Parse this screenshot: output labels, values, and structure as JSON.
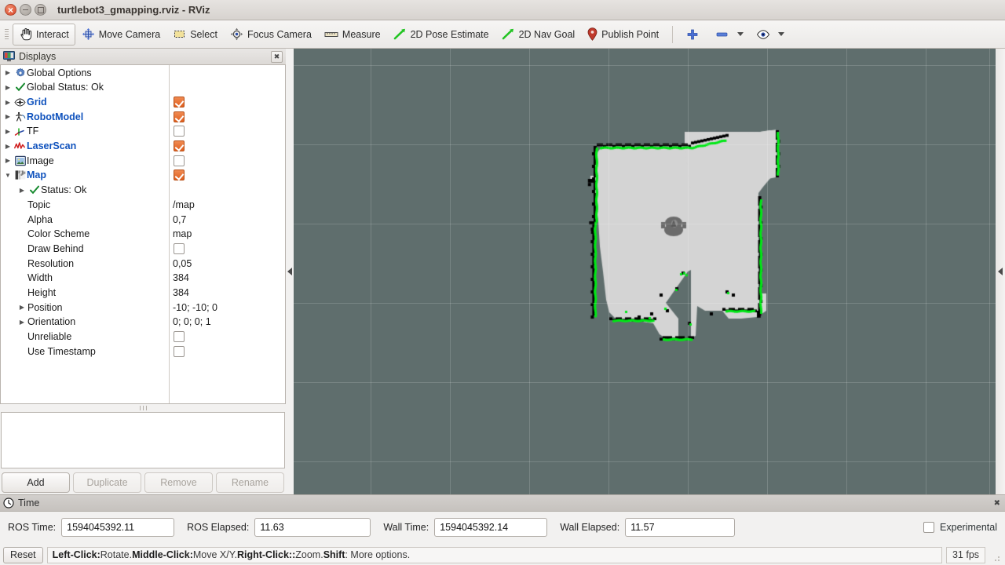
{
  "window": {
    "title": "turtlebot3_gmapping.rviz - RViz",
    "controls": [
      "close-button",
      "minimize-button",
      "maximize-button"
    ]
  },
  "toolbar": {
    "items": [
      {
        "label": "Interact",
        "icon": "hand-cursor-icon",
        "active": true
      },
      {
        "label": "Move Camera",
        "icon": "move-camera-icon",
        "active": false
      },
      {
        "label": "Select",
        "icon": "select-rect-icon",
        "active": false
      },
      {
        "label": "Focus Camera",
        "icon": "focus-camera-icon",
        "active": false
      },
      {
        "label": "Measure",
        "icon": "ruler-icon",
        "active": false
      },
      {
        "label": "2D Pose Estimate",
        "icon": "green-arrow-icon",
        "active": false
      },
      {
        "label": "2D Nav Goal",
        "icon": "green-arrow-icon",
        "active": false
      },
      {
        "label": "Publish Point",
        "icon": "map-pin-icon",
        "active": false
      }
    ],
    "right_icons": [
      "plus-icon",
      "minus-bar-icon",
      "eye-icon"
    ]
  },
  "displays_panel": {
    "title": "Displays",
    "icon": "displays-monitor-icon",
    "close_label": "✖",
    "tree": [
      {
        "label": "Global Options",
        "icon": "gear-icon",
        "indent": 0,
        "expander": "collapsed",
        "enabled_style": "plain",
        "checkbox": null
      },
      {
        "label": "Global Status: Ok",
        "icon": "check-icon",
        "indent": 0,
        "expander": "collapsed",
        "enabled_style": "plain",
        "checkbox": null
      },
      {
        "label": "Grid",
        "icon": "grid-icon",
        "indent": 0,
        "expander": "collapsed",
        "enabled_style": "enabled",
        "checkbox": "checked"
      },
      {
        "label": "RobotModel",
        "icon": "robot-icon",
        "indent": 0,
        "expander": "collapsed",
        "enabled_style": "enabled",
        "checkbox": "checked"
      },
      {
        "label": "TF",
        "icon": "tf-axes-icon",
        "indent": 0,
        "expander": "collapsed",
        "enabled_style": "plain",
        "checkbox": "unchecked"
      },
      {
        "label": "LaserScan",
        "icon": "laserscan-icon",
        "indent": 0,
        "expander": "collapsed",
        "enabled_style": "enabled",
        "checkbox": "checked"
      },
      {
        "label": "Image",
        "icon": "image-icon",
        "indent": 0,
        "expander": "collapsed",
        "enabled_style": "plain",
        "checkbox": "unchecked"
      },
      {
        "label": "Map",
        "icon": "map-icon",
        "indent": 0,
        "expander": "expanded",
        "enabled_style": "enabled",
        "checkbox": "checked"
      },
      {
        "label": "Status: Ok",
        "icon": "check-icon",
        "indent": 1,
        "expander": "collapsed",
        "enabled_style": "plain",
        "checkbox": null
      },
      {
        "label": "Topic",
        "icon": null,
        "indent": 1,
        "expander": "none",
        "enabled_style": "property",
        "value": "/map"
      },
      {
        "label": "Alpha",
        "icon": null,
        "indent": 1,
        "expander": "none",
        "enabled_style": "property",
        "value": "0,7"
      },
      {
        "label": "Color Scheme",
        "icon": null,
        "indent": 1,
        "expander": "none",
        "enabled_style": "property",
        "value": "map"
      },
      {
        "label": "Draw Behind",
        "icon": null,
        "indent": 1,
        "expander": "none",
        "enabled_style": "property",
        "checkbox": "unchecked"
      },
      {
        "label": "Resolution",
        "icon": null,
        "indent": 1,
        "expander": "none",
        "enabled_style": "property",
        "value": "0,05"
      },
      {
        "label": "Width",
        "icon": null,
        "indent": 1,
        "expander": "none",
        "enabled_style": "property",
        "value": "384"
      },
      {
        "label": "Height",
        "icon": null,
        "indent": 1,
        "expander": "none",
        "enabled_style": "property",
        "value": "384"
      },
      {
        "label": "Position",
        "icon": null,
        "indent": 1,
        "expander": "collapsed",
        "enabled_style": "property",
        "value": "-10; -10; 0"
      },
      {
        "label": "Orientation",
        "icon": null,
        "indent": 1,
        "expander": "collapsed",
        "enabled_style": "property",
        "value": "0; 0; 0; 1"
      },
      {
        "label": "Unreliable",
        "icon": null,
        "indent": 1,
        "expander": "none",
        "enabled_style": "property",
        "checkbox": "unchecked"
      },
      {
        "label": "Use Timestamp",
        "icon": null,
        "indent": 1,
        "expander": "none",
        "enabled_style": "property",
        "checkbox": "unchecked"
      }
    ],
    "buttons": [
      {
        "label": "Add",
        "enabled": true
      },
      {
        "label": "Duplicate",
        "enabled": false
      },
      {
        "label": "Remove",
        "enabled": false
      },
      {
        "label": "Rename",
        "enabled": false
      }
    ]
  },
  "view3d": {
    "background_color": "#5f6e6d",
    "grid_color": "#7e8b8a",
    "map_free_color": "#d4d4d4",
    "map_occupied_color": "#000000",
    "laser_color": "#00e816",
    "robot_color": "#6b6b6b"
  },
  "time_panel": {
    "title": "Time",
    "icon": "clock-icon",
    "close_label": "✖",
    "fields": [
      {
        "label": "ROS Time:",
        "value": "1594045392.11"
      },
      {
        "label": "ROS Elapsed:",
        "value": "11.63"
      },
      {
        "label": "Wall Time:",
        "value": "1594045392.14"
      },
      {
        "label": "Wall Elapsed:",
        "value": "11.57"
      }
    ],
    "experimental_label": "Experimental",
    "experimental_checked": false
  },
  "status_bar": {
    "reset_label": "Reset",
    "hint_parts": [
      {
        "text": "Left-Click:",
        "bold": true
      },
      {
        "text": " Rotate. ",
        "bold": false
      },
      {
        "text": "Middle-Click:",
        "bold": true
      },
      {
        "text": " Move X/Y. ",
        "bold": false
      },
      {
        "text": "Right-Click::",
        "bold": true
      },
      {
        "text": " Zoom. ",
        "bold": false
      },
      {
        "text": "Shift",
        "bold": true
      },
      {
        "text": ": More options.",
        "bold": false
      }
    ],
    "fps": "31 fps"
  }
}
